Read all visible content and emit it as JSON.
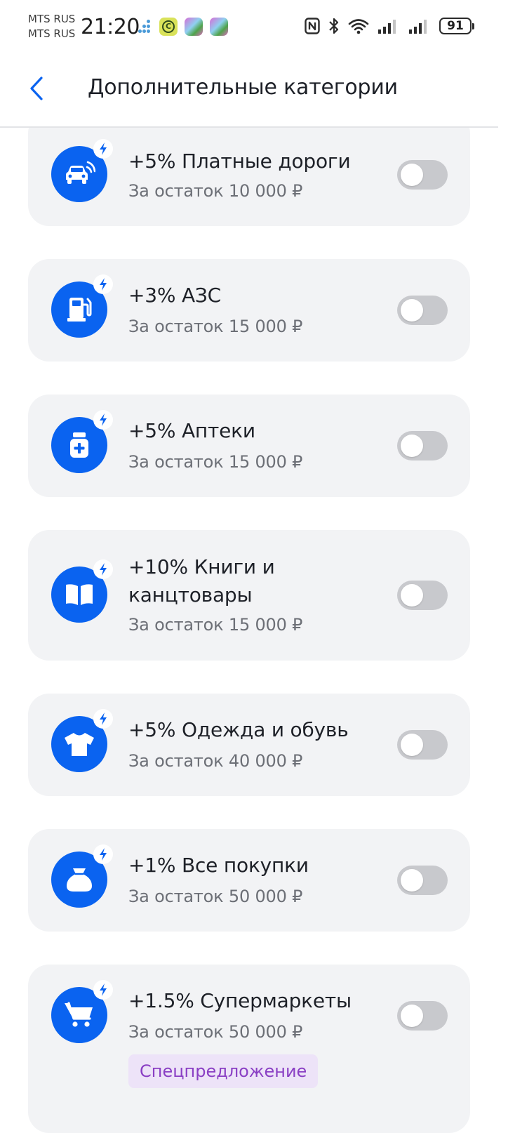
{
  "status_bar": {
    "carrier_1": "MTS RUS",
    "carrier_2": "MTS RUS",
    "time": "21:20",
    "battery": "91"
  },
  "header": {
    "title": "Дополнительные категории"
  },
  "categories": [
    {
      "title": "+5% Платные дороги",
      "subtitle": "За остаток 10 000 ₽",
      "icon": "car-wifi-icon",
      "enabled": false
    },
    {
      "title": "+3% АЗС",
      "subtitle": "За остаток 15 000 ₽",
      "icon": "fuel-pump-icon",
      "enabled": false
    },
    {
      "title": "+5% Аптеки",
      "subtitle": "За остаток 15 000 ₽",
      "icon": "medicine-jar-icon",
      "enabled": false
    },
    {
      "title": "+10% Книги и канцтовары",
      "subtitle": "За остаток 15 000 ₽",
      "icon": "book-icon",
      "enabled": false
    },
    {
      "title": "+5% Одежда и обувь",
      "subtitle": "За остаток 40 000 ₽",
      "icon": "t-shirt-icon",
      "enabled": false
    },
    {
      "title": "+1% Все покупки",
      "subtitle": "За остаток 50 000 ₽",
      "icon": "money-bag-icon",
      "enabled": false
    },
    {
      "title": "+1.5% Супермаркеты",
      "subtitle": "За остаток 50 000 ₽",
      "icon": "shopping-cart-icon",
      "enabled": false,
      "badge": "Спецпредложение"
    }
  ],
  "colors": {
    "accent": "#0a63f0",
    "card_bg": "#f2f3f5",
    "toggle_off": "#c8c9cd",
    "badge_bg": "#ede3f8",
    "badge_text": "#8a3fc4"
  }
}
